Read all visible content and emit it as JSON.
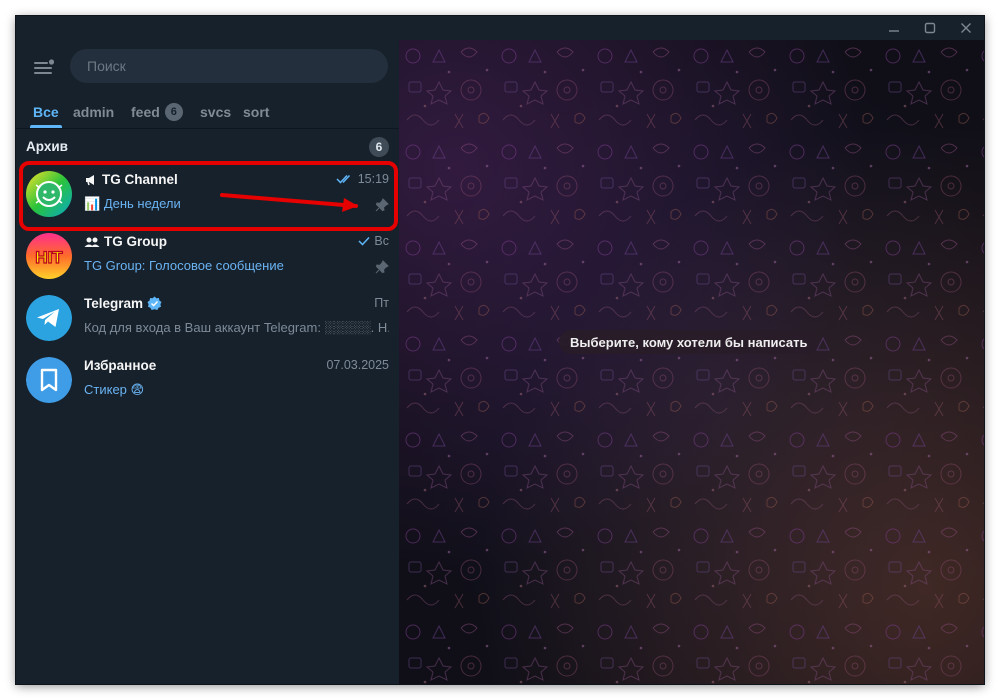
{
  "window": {
    "controls": [
      "minimize",
      "maximize",
      "close"
    ]
  },
  "sidebar": {
    "search": {
      "placeholder": "Поиск"
    },
    "tabs": [
      {
        "label": "Все",
        "active": true
      },
      {
        "label": "admin"
      },
      {
        "label": "feed",
        "badge": "6"
      },
      {
        "label": "svcs"
      },
      {
        "label": "sort"
      }
    ],
    "archive": {
      "title": "Архив",
      "count": "6"
    },
    "chats": [
      {
        "name": "TG Channel",
        "type": "channel",
        "time": "15:19",
        "read": "double-check",
        "preview_icon": "📊",
        "preview": "День недели",
        "pinned": true,
        "highlighted": true
      },
      {
        "name": "TG Group",
        "type": "group",
        "time": "Вс",
        "read": "single-check",
        "preview": "TG Group: Голосовое сообщение",
        "pinned": true,
        "avatar_text": "HIT"
      },
      {
        "name": "Telegram",
        "type": "verified",
        "time": "Пт",
        "preview": "Код для входа в Ваш аккаунт Telegram: ░░░░░. Н..."
      },
      {
        "name": "Избранное",
        "type": "saved",
        "time": "07.03.2025",
        "preview": "Стикер 😨"
      }
    ]
  },
  "main": {
    "empty_hint": "Выберите, кому хотели бы написать"
  },
  "colors": {
    "sidebar_bg": "#17212b",
    "accent": "#5eb5f7",
    "highlight": "#e60000"
  }
}
